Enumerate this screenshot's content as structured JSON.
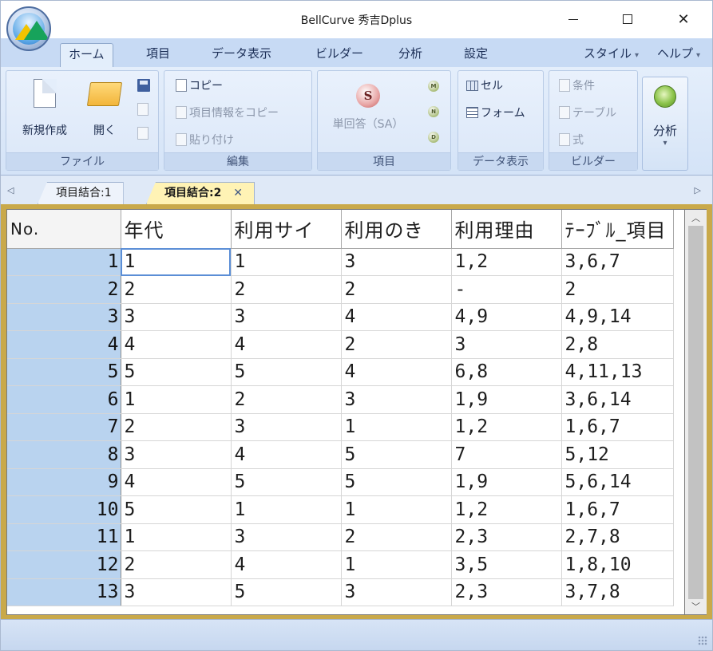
{
  "window": {
    "title": "BellCurve 秀吉Dplus",
    "minimize": "—",
    "maximize": "☐",
    "close": "✕"
  },
  "ribbon_tabs": [
    {
      "label": "ホーム",
      "active": true
    },
    {
      "label": "項目"
    },
    {
      "label": "データ表示"
    },
    {
      "label": "ビルダー"
    },
    {
      "label": "分析"
    },
    {
      "label": "設定"
    }
  ],
  "ribbon_right": {
    "style": "スタイル",
    "help": "ヘルプ",
    "caret": "▾"
  },
  "groups": {
    "file": {
      "label": "ファイル",
      "new": "新規作成",
      "open": "開く"
    },
    "edit": {
      "label": "編集",
      "copy": "コピー",
      "copy_info": "項目情報をコピー",
      "paste": "貼り付け"
    },
    "item": {
      "label": "項目",
      "single": "単回答（SA）",
      "s_icon": "S",
      "m_icon": "M",
      "n_icon": "N",
      "d_icon": "D"
    },
    "data_display": {
      "label": "データ表示",
      "cell": "セル",
      "form": "フォーム"
    },
    "builder": {
      "label": "ビルダー",
      "condition": "条件",
      "table": "テーブル",
      "formula": "式"
    },
    "analysis": {
      "label": "分析",
      "caret": "▾"
    }
  },
  "doc_tabs": [
    {
      "label": "項目結合:1",
      "active": false
    },
    {
      "label": "項目結合:2",
      "active": true,
      "close": "✕"
    }
  ],
  "nav": {
    "left": "◁",
    "right": "▷"
  },
  "grid": {
    "headers": [
      "No.",
      "年代",
      "利用サイ",
      "利用のき",
      "利用理由",
      "ﾃｰﾌﾞﾙ_項目"
    ],
    "rows": [
      [
        "1",
        "1",
        "1",
        "3",
        "1,2",
        "3,6,7"
      ],
      [
        "2",
        "2",
        "2",
        "2",
        "-",
        "2"
      ],
      [
        "3",
        "3",
        "3",
        "4",
        "4,9",
        "4,9,14"
      ],
      [
        "4",
        "4",
        "4",
        "2",
        "3",
        "2,8"
      ],
      [
        "5",
        "5",
        "5",
        "4",
        "6,8",
        "4,11,13"
      ],
      [
        "6",
        "1",
        "2",
        "3",
        "1,9",
        "3,6,14"
      ],
      [
        "7",
        "2",
        "3",
        "1",
        "1,2",
        "1,6,7"
      ],
      [
        "8",
        "3",
        "4",
        "5",
        "7",
        "5,12"
      ],
      [
        "9",
        "4",
        "5",
        "5",
        "1,9",
        "5,6,14"
      ],
      [
        "10",
        "5",
        "1",
        "1",
        "1,2",
        "1,6,7"
      ],
      [
        "11",
        "1",
        "3",
        "2",
        "2,3",
        "2,7,8"
      ],
      [
        "12",
        "2",
        "4",
        "1",
        "3,5",
        "1,8,10"
      ],
      [
        "13",
        "3",
        "5",
        "3",
        "2,3",
        "3,7,8"
      ]
    ],
    "selected_cell": {
      "row": 0,
      "col": 1
    }
  },
  "scroll": {
    "up": "︿",
    "down": "﹀"
  },
  "colors": {
    "row_header": "#b9d3ef",
    "active_tab": "#fff3b5",
    "frame": "#c9a94a",
    "ribbon": "#c7daf4"
  }
}
